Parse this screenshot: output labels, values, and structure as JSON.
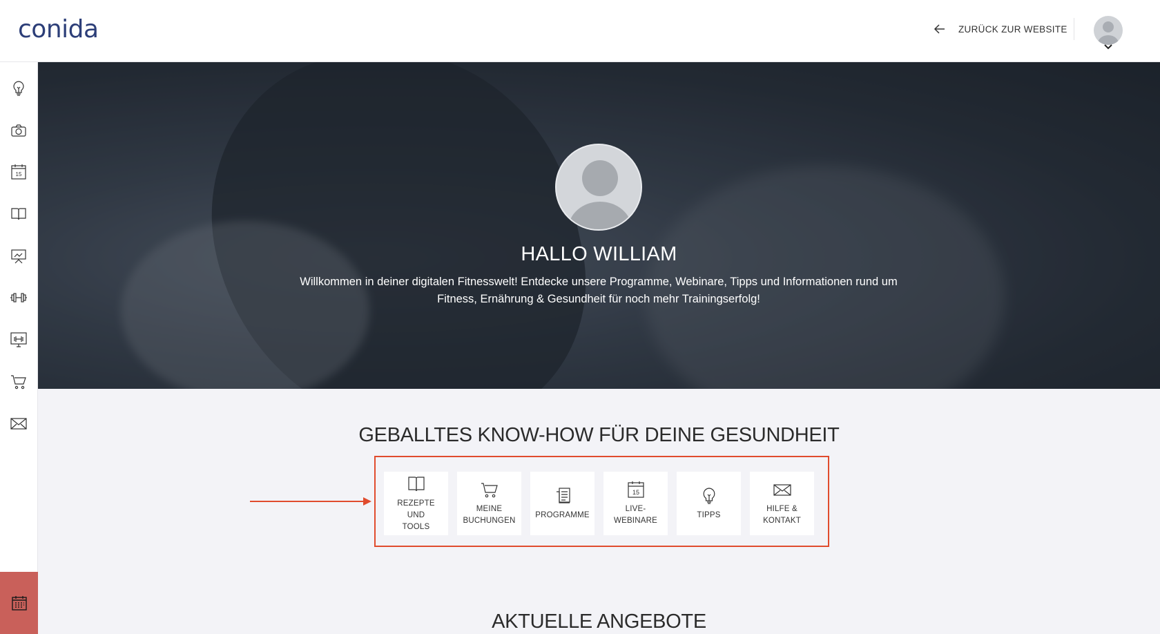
{
  "header": {
    "logo": "conida",
    "back_link": "ZURÜCK ZUR WEBSITE"
  },
  "sidebar": {
    "items": [
      {
        "icon": "lightbulb-icon"
      },
      {
        "icon": "camera-icon"
      },
      {
        "icon": "calendar-icon",
        "day": "15"
      },
      {
        "icon": "book-icon"
      },
      {
        "icon": "presentation-icon"
      },
      {
        "icon": "dumbbell-icon"
      },
      {
        "icon": "monitor-dumbbell-icon"
      },
      {
        "icon": "cart-icon"
      },
      {
        "icon": "mail-icon"
      }
    ],
    "bottom_icon": "calendar-grid-icon",
    "bottom_color": "#c9605a"
  },
  "hero": {
    "title": "HALLO WILLIAM",
    "text": "Willkommen in deiner digitalen Fitnesswelt! Entdecke unsere Programme, Webinare, Tipps und Informationen rund um Fitness, Ernährung & Gesundheit für noch mehr Trainingserfolg!"
  },
  "knowhow": {
    "title": "GEBALLTES KNOW-HOW FÜR DEINE GESUNDHEIT",
    "highlight_color": "#e04b2d",
    "tiles": [
      {
        "label": "REZEPTE UND TOOLS",
        "icon": "book-icon"
      },
      {
        "label": "MEINE BUCHUNGEN",
        "icon": "cart-icon"
      },
      {
        "label": "PROGRAMME",
        "icon": "document-icon"
      },
      {
        "label": "LIVE-WEBINARE",
        "icon": "calendar-icon",
        "day": "15"
      },
      {
        "label": "TIPPS",
        "icon": "lightbulb-icon"
      },
      {
        "label": "HILFE & KONTAKT",
        "icon": "mail-icon"
      }
    ]
  },
  "offers": {
    "title": "AKTUELLE ANGEBOTE"
  }
}
